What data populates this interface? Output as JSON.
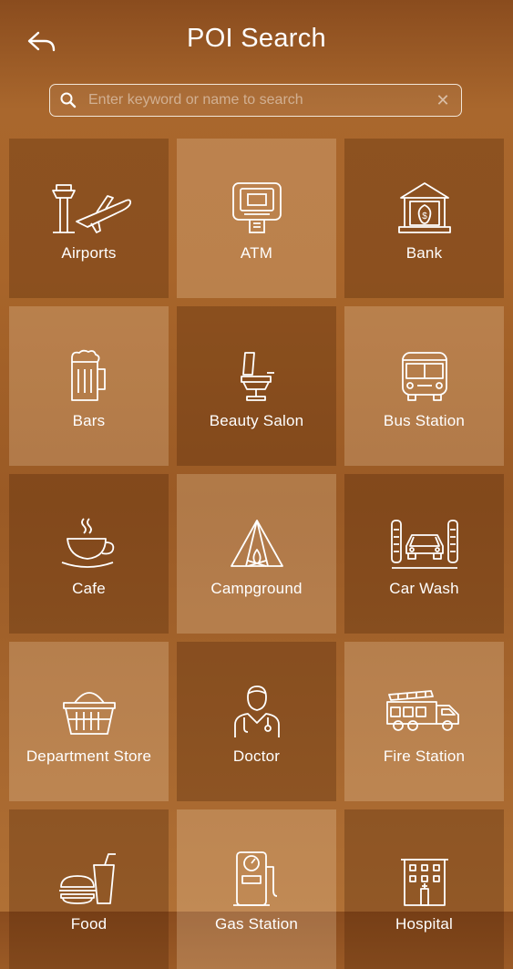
{
  "header": {
    "title": "POI Search"
  },
  "search": {
    "placeholder": "Enter keyword or name to search"
  },
  "categories": [
    {
      "label": "Airports"
    },
    {
      "label": "ATM"
    },
    {
      "label": "Bank"
    },
    {
      "label": "Bars"
    },
    {
      "label": "Beauty Salon"
    },
    {
      "label": "Bus Station"
    },
    {
      "label": "Cafe"
    },
    {
      "label": "Campground"
    },
    {
      "label": "Car Wash"
    },
    {
      "label": "Department Store"
    },
    {
      "label": "Doctor"
    },
    {
      "label": "Fire Station"
    },
    {
      "label": "Food"
    },
    {
      "label": "Gas Station"
    },
    {
      "label": "Hospital"
    }
  ]
}
